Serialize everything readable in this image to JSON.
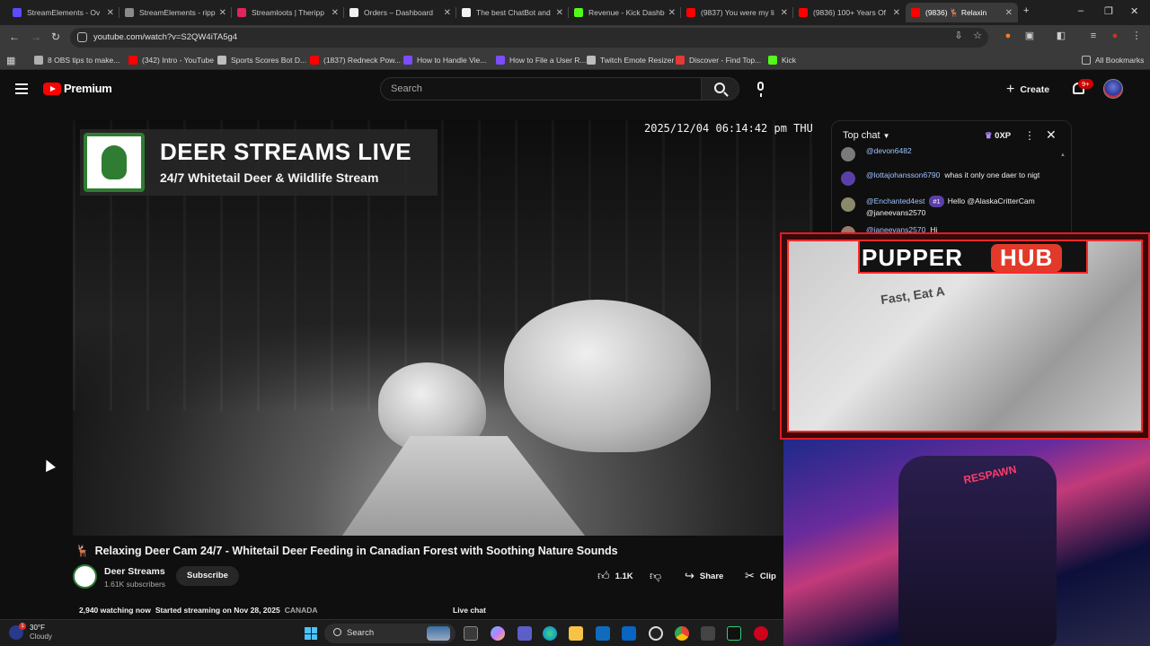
{
  "browser": {
    "tabs": [
      {
        "label": "StreamElements - Ov",
        "color": "#5b4dff"
      },
      {
        "label": "StreamElements - ripp",
        "color": "#8a8a8a"
      },
      {
        "label": "Streamloots | Theripp",
        "color": "#e0245e"
      },
      {
        "label": "Orders – Dashboard",
        "color": "#f1f1f1"
      },
      {
        "label": "The best ChatBot and",
        "color": "#f1f1f1"
      },
      {
        "label": "Revenue - Kick Dashb",
        "color": "#53fc18"
      },
      {
        "label": "(9837) You were my li",
        "color": "#ff0000"
      },
      {
        "label": "(9836) 100+ Years Of",
        "color": "#ff0000"
      },
      {
        "label": "(9836) 🦌 Relaxin",
        "color": "#ff0000"
      }
    ],
    "new_tab": "+",
    "window_controls": [
      "–",
      "❐",
      "✕"
    ],
    "url": "youtube.com/watch?v=S2QW4iTA5g4",
    "bookmarks": [
      {
        "label": "8 OBS tips to make...",
        "color": "#b0b0b0"
      },
      {
        "label": "(342) Intro - YouTube",
        "color": "#ff0000"
      },
      {
        "label": "Sports Scores Bot D...",
        "color": "#bdbdbd"
      },
      {
        "label": "(1837) Redneck Pow...",
        "color": "#ff0000"
      },
      {
        "label": "How to Handle Vie...",
        "color": "#7c4dff"
      },
      {
        "label": "How to File a User R...",
        "color": "#7c4dff"
      },
      {
        "label": "Twitch Emote Resizer",
        "color": "#bdbdbd"
      },
      {
        "label": "Discover - Find Top...",
        "color": "#e53935"
      },
      {
        "label": "Kick",
        "color": "#53fc18"
      }
    ],
    "all_bookmarks": "All Bookmarks"
  },
  "youtube": {
    "brand": "Premium",
    "search_placeholder": "Search",
    "create_label": "Create",
    "notif_count": "9+"
  },
  "video": {
    "overlay_title": "DEER STREAMS LIVE",
    "overlay_subtitle": "24/7 Whitetail Deer & Wildlife Stream",
    "timestamp": "2025/12/04 06:14:42 pm THU",
    "title": "Relaxing Deer Cam 24/7 - Whitetail Deer Feeding in Canadian Forest with Soothing Nature Sounds",
    "title_emoji": "🦌",
    "channel_name": "Deer Streams",
    "subscribers": "1.61K subscribers",
    "subscribe_label": "Subscribe",
    "likes": "1.1K",
    "share_label": "Share",
    "clip_label": "Clip",
    "watching": "2,940 watching now",
    "started": "Started streaming on Nov 28, 2025",
    "location": "CANADA",
    "live_chat_label": "Live chat"
  },
  "chat": {
    "header": "Top chat",
    "xp": "0XP",
    "messages": [
      {
        "author": "@devon6482",
        "rank": "",
        "text": "",
        "avatar": "#7a7a7a"
      },
      {
        "author": "@lottajohansson6790",
        "rank": "",
        "text": "whas it only one daer to nigt",
        "avatar": "#5b3fa8"
      },
      {
        "author": "@Enchanted4est",
        "rank": "#1",
        "text": "Hello @AlaskaCritterCam @janeevans2570",
        "avatar": "#8a8a6a"
      },
      {
        "author": "@janeevans2570",
        "rank": "",
        "text": "Hi",
        "avatar": "#9a7a6a"
      }
    ]
  },
  "overlay": {
    "pupper_word1": "PUPPER",
    "pupper_word2": "HUB",
    "shirt_text": "Fast, Eat A",
    "chair_text": "RESPAWN"
  },
  "taskbar": {
    "temperature": "30°F",
    "condition": "Cloudy",
    "weather_alert": "1",
    "search_label": "Search"
  }
}
